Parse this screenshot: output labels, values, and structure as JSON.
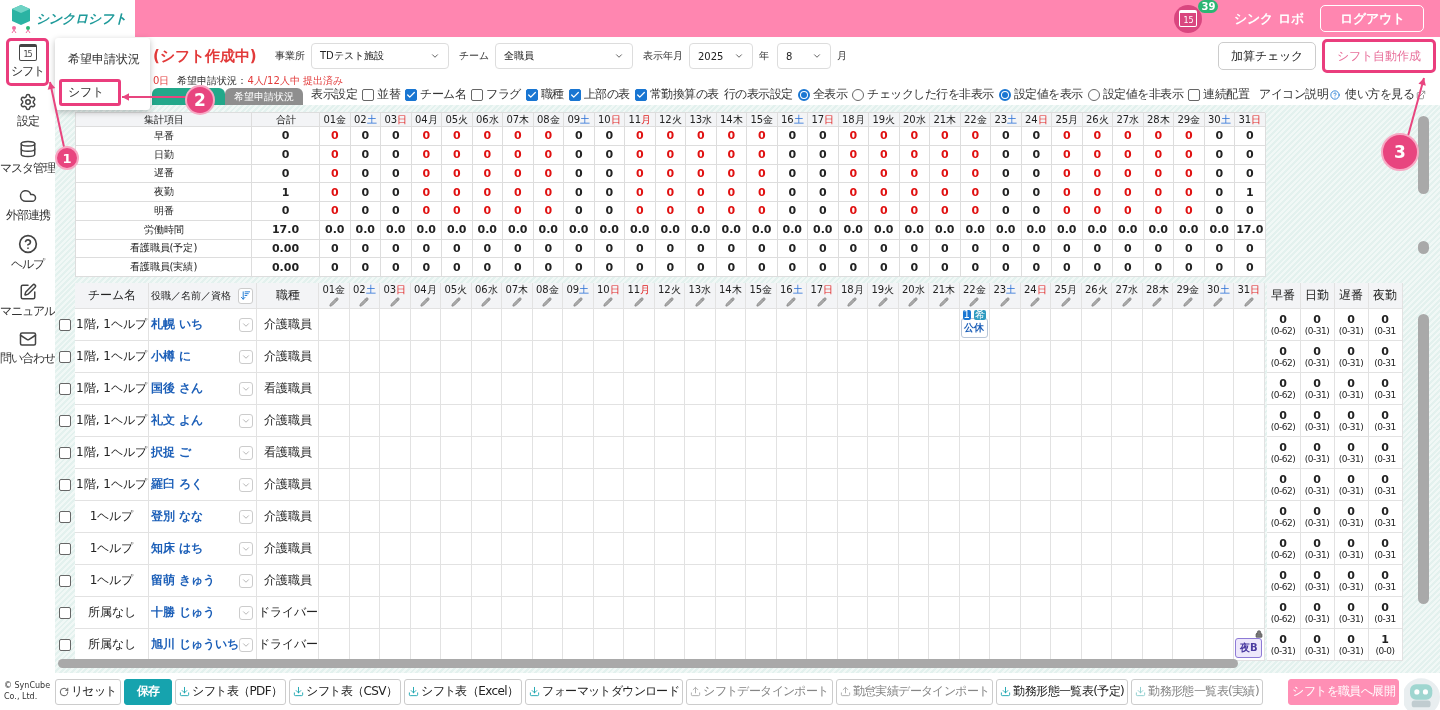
{
  "header": {
    "logo": "シンクロシフト",
    "calendar_day": "15",
    "notification_count": "39",
    "user": "シンク ロボ",
    "logout": "ログアウト"
  },
  "sidebar": {
    "items": [
      {
        "kind": "calendar",
        "label": "シフト",
        "icon_text": "15",
        "highlighted": true
      },
      {
        "kind": "gear",
        "label": "設定",
        "highlighted": false
      },
      {
        "kind": "database",
        "label": "マスタ管理",
        "highlighted": false
      },
      {
        "kind": "cloud",
        "label": "外部連携",
        "highlighted": false
      },
      {
        "kind": "help",
        "label": "ヘルプ",
        "highlighted": false
      },
      {
        "kind": "manual",
        "label": "マニュアル",
        "highlighted": false
      },
      {
        "kind": "mail",
        "label": "問い合わせ",
        "highlighted": false
      }
    ],
    "copyright": "© SynCube Co., Ltd."
  },
  "popup_menu": {
    "items": [
      {
        "label": "希望申請状況",
        "highlighted": false
      },
      {
        "label": "シフト",
        "highlighted": true
      }
    ]
  },
  "title": "(シフト作成中)",
  "deadline_fragment": "0日",
  "request_status": {
    "label": "希望申請状況：",
    "value": "4人/12人中 提出済み"
  },
  "tabs": [
    {
      "selected": true
    },
    {
      "label": "希望申請状況",
      "selected": false
    }
  ],
  "filters": [
    {
      "label": "事業所",
      "value": "TDテスト施設",
      "kind": "wide"
    },
    {
      "label": "チーム",
      "value": "全職員",
      "kind": "wide"
    },
    {
      "label": "表示年月",
      "value": "2025",
      "suffix": "年",
      "kind": "narrow"
    },
    {
      "value": "8",
      "suffix": "月",
      "kind": "narrow"
    }
  ],
  "actions": [
    {
      "label": "加算チェック",
      "highlighted": false
    },
    {
      "label": "シフト自動作成",
      "highlighted": true
    }
  ],
  "display_settings": {
    "label": "表示設定",
    "checkboxes": [
      {
        "label": "並替",
        "checked": false
      },
      {
        "label": "チーム名",
        "checked": true
      },
      {
        "label": "フラグ",
        "checked": false
      },
      {
        "label": "職種",
        "checked": true
      },
      {
        "label": "上部の表",
        "checked": true
      },
      {
        "label": "常勤換算の表",
        "checked": true
      }
    ],
    "row_label": "行の表示設定",
    "row_radios": [
      {
        "label": "全表示",
        "selected": true
      },
      {
        "label": "チェックした行を非表示",
        "selected": false
      }
    ],
    "value_radios": [
      {
        "label": "設定値を表示",
        "selected": true
      },
      {
        "label": "設定値を非表示",
        "selected": false
      }
    ],
    "continuous": {
      "label": "連続配置",
      "checked": false
    },
    "icon_help": "アイコン説明",
    "how_to": "使い方を見る"
  },
  "summary": {
    "columns": {
      "item": "集計項目",
      "total": "合計"
    },
    "days": [
      {
        "num": "01",
        "wd": "金",
        "kind": "weekday"
      },
      {
        "num": "02",
        "wd": "土",
        "kind": "saturday"
      },
      {
        "num": "03",
        "wd": "日",
        "kind": "holiday"
      },
      {
        "num": "04",
        "wd": "月",
        "kind": "weekday"
      },
      {
        "num": "05",
        "wd": "火",
        "kind": "weekday"
      },
      {
        "num": "06",
        "wd": "水",
        "kind": "weekday"
      },
      {
        "num": "07",
        "wd": "木",
        "kind": "weekday"
      },
      {
        "num": "08",
        "wd": "金",
        "kind": "weekday"
      },
      {
        "num": "09",
        "wd": "土",
        "kind": "saturday"
      },
      {
        "num": "10",
        "wd": "日",
        "kind": "holiday"
      },
      {
        "num": "11",
        "wd": "月",
        "kind": "holiday"
      },
      {
        "num": "12",
        "wd": "火",
        "kind": "weekday"
      },
      {
        "num": "13",
        "wd": "水",
        "kind": "weekday"
      },
      {
        "num": "14",
        "wd": "木",
        "kind": "weekday"
      },
      {
        "num": "15",
        "wd": "金",
        "kind": "weekday"
      },
      {
        "num": "16",
        "wd": "土",
        "kind": "saturday"
      },
      {
        "num": "17",
        "wd": "日",
        "kind": "holiday"
      },
      {
        "num": "18",
        "wd": "月",
        "kind": "weekday"
      },
      {
        "num": "19",
        "wd": "火",
        "kind": "weekday"
      },
      {
        "num": "20",
        "wd": "水",
        "kind": "weekday"
      },
      {
        "num": "21",
        "wd": "木",
        "kind": "weekday"
      },
      {
        "num": "22",
        "wd": "金",
        "kind": "weekday"
      },
      {
        "num": "23",
        "wd": "土",
        "kind": "saturday"
      },
      {
        "num": "24",
        "wd": "日",
        "kind": "holiday"
      },
      {
        "num": "25",
        "wd": "月",
        "kind": "weekday"
      },
      {
        "num": "26",
        "wd": "火",
        "kind": "weekday"
      },
      {
        "num": "27",
        "wd": "水",
        "kind": "weekday"
      },
      {
        "num": "28",
        "wd": "木",
        "kind": "weekday"
      },
      {
        "num": "29",
        "wd": "金",
        "kind": "weekday"
      },
      {
        "num": "30",
        "wd": "土",
        "kind": "saturday"
      },
      {
        "num": "31",
        "wd": "日",
        "kind": "holiday"
      }
    ],
    "rows": [
      {
        "label": "早番",
        "total": "0",
        "values": [
          "0",
          "0",
          "0",
          "0",
          "0",
          "0",
          "0",
          "0",
          "0",
          "0",
          "0",
          "0",
          "0",
          "0",
          "0",
          "0",
          "0",
          "0",
          "0",
          "0",
          "0",
          "0",
          "0",
          "0",
          "0",
          "0",
          "0",
          "0",
          "0",
          "0",
          "0"
        ],
        "alerts": [
          true,
          false,
          false,
          true,
          true,
          true,
          true,
          true,
          false,
          false,
          true,
          true,
          true,
          true,
          true,
          false,
          false,
          true,
          true,
          true,
          true,
          true,
          false,
          false,
          true,
          true,
          true,
          true,
          true,
          false,
          false
        ]
      },
      {
        "label": "日勤",
        "total": "0",
        "values": [
          "0",
          "0",
          "0",
          "0",
          "0",
          "0",
          "0",
          "0",
          "0",
          "0",
          "0",
          "0",
          "0",
          "0",
          "0",
          "0",
          "0",
          "0",
          "0",
          "0",
          "0",
          "0",
          "0",
          "0",
          "0",
          "0",
          "0",
          "0",
          "0",
          "0",
          "0"
        ],
        "alerts": [
          true,
          false,
          false,
          true,
          true,
          true,
          true,
          true,
          false,
          false,
          true,
          true,
          true,
          true,
          true,
          false,
          false,
          true,
          true,
          true,
          true,
          true,
          false,
          false,
          true,
          true,
          true,
          true,
          true,
          false,
          false
        ]
      },
      {
        "label": "遅番",
        "total": "0",
        "values": [
          "0",
          "0",
          "0",
          "0",
          "0",
          "0",
          "0",
          "0",
          "0",
          "0",
          "0",
          "0",
          "0",
          "0",
          "0",
          "0",
          "0",
          "0",
          "0",
          "0",
          "0",
          "0",
          "0",
          "0",
          "0",
          "0",
          "0",
          "0",
          "0",
          "0",
          "0"
        ],
        "alerts": [
          true,
          false,
          false,
          true,
          true,
          true,
          true,
          true,
          false,
          false,
          true,
          true,
          true,
          true,
          true,
          false,
          false,
          true,
          true,
          true,
          true,
          true,
          false,
          false,
          true,
          true,
          true,
          true,
          true,
          false,
          false
        ]
      },
      {
        "label": "夜勤",
        "total": "1",
        "values": [
          "0",
          "0",
          "0",
          "0",
          "0",
          "0",
          "0",
          "0",
          "0",
          "0",
          "0",
          "0",
          "0",
          "0",
          "0",
          "0",
          "0",
          "0",
          "0",
          "0",
          "0",
          "0",
          "0",
          "0",
          "0",
          "0",
          "0",
          "0",
          "0",
          "0",
          "1"
        ],
        "alerts": [
          true,
          false,
          false,
          true,
          true,
          true,
          true,
          true,
          false,
          false,
          true,
          true,
          true,
          true,
          true,
          false,
          false,
          true,
          true,
          true,
          true,
          true,
          false,
          false,
          true,
          true,
          true,
          true,
          true,
          false,
          false
        ]
      },
      {
        "label": "明番",
        "total": "0",
        "values": [
          "0",
          "0",
          "0",
          "0",
          "0",
          "0",
          "0",
          "0",
          "0",
          "0",
          "0",
          "0",
          "0",
          "0",
          "0",
          "0",
          "0",
          "0",
          "0",
          "0",
          "0",
          "0",
          "0",
          "0",
          "0",
          "0",
          "0",
          "0",
          "0",
          "0",
          "0"
        ],
        "alerts": [
          true,
          false,
          false,
          true,
          true,
          true,
          true,
          true,
          false,
          false,
          true,
          true,
          true,
          true,
          true,
          false,
          false,
          true,
          true,
          true,
          true,
          true,
          false,
          false,
          true,
          true,
          true,
          true,
          true,
          false,
          false
        ]
      },
      {
        "label": "労働時間",
        "total": "17.0",
        "values": [
          "0.0",
          "0.0",
          "0.0",
          "0.0",
          "0.0",
          "0.0",
          "0.0",
          "0.0",
          "0.0",
          "0.0",
          "0.0",
          "0.0",
          "0.0",
          "0.0",
          "0.0",
          "0.0",
          "0.0",
          "0.0",
          "0.0",
          "0.0",
          "0.0",
          "0.0",
          "0.0",
          "0.0",
          "0.0",
          "0.0",
          "0.0",
          "0.0",
          "0.0",
          "0.0",
          "17.0"
        ]
      },
      {
        "label": "看護職員(予定)",
        "total": "0.00",
        "values": [
          "0",
          "0",
          "0",
          "0",
          "0",
          "0",
          "0",
          "0",
          "0",
          "0",
          "0",
          "0",
          "0",
          "0",
          "0",
          "0",
          "0",
          "0",
          "0",
          "0",
          "0",
          "0",
          "0",
          "0",
          "0",
          "0",
          "0",
          "0",
          "0",
          "0",
          "0"
        ]
      },
      {
        "label": "看護職員(実績)",
        "total": "0.00",
        "values": [
          "0",
          "0",
          "0",
          "0",
          "0",
          "0",
          "0",
          "0",
          "0",
          "0",
          "0",
          "0",
          "0",
          "0",
          "0",
          "0",
          "0",
          "0",
          "0",
          "0",
          "0",
          "0",
          "0",
          "0",
          "0",
          "0",
          "0",
          "0",
          "0",
          "0",
          "0"
        ]
      }
    ]
  },
  "staff": {
    "columns": {
      "team": "チーム名",
      "name": "役職／名前／資格",
      "job": "職種"
    },
    "days": [
      {
        "num": "01",
        "wd": "金",
        "kind": "weekday"
      },
      {
        "num": "02",
        "wd": "土",
        "kind": "saturday"
      },
      {
        "num": "03",
        "wd": "日",
        "kind": "holiday"
      },
      {
        "num": "04",
        "wd": "月",
        "kind": "weekday"
      },
      {
        "num": "05",
        "wd": "火",
        "kind": "weekday"
      },
      {
        "num": "06",
        "wd": "水",
        "kind": "weekday"
      },
      {
        "num": "07",
        "wd": "木",
        "kind": "weekday"
      },
      {
        "num": "08",
        "wd": "金",
        "kind": "weekday"
      },
      {
        "num": "09",
        "wd": "土",
        "kind": "saturday"
      },
      {
        "num": "10",
        "wd": "日",
        "kind": "holiday"
      },
      {
        "num": "11",
        "wd": "月",
        "kind": "holiday"
      },
      {
        "num": "12",
        "wd": "火",
        "kind": "weekday"
      },
      {
        "num": "13",
        "wd": "水",
        "kind": "weekday"
      },
      {
        "num": "14",
        "wd": "木",
        "kind": "weekday"
      },
      {
        "num": "15",
        "wd": "金",
        "kind": "weekday"
      },
      {
        "num": "16",
        "wd": "土",
        "kind": "saturday"
      },
      {
        "num": "17",
        "wd": "日",
        "kind": "holiday"
      },
      {
        "num": "18",
        "wd": "月",
        "kind": "weekday"
      },
      {
        "num": "19",
        "wd": "火",
        "kind": "weekday"
      },
      {
        "num": "20",
        "wd": "水",
        "kind": "weekday"
      },
      {
        "num": "21",
        "wd": "木",
        "kind": "weekday"
      },
      {
        "num": "22",
        "wd": "金",
        "kind": "weekday"
      },
      {
        "num": "23",
        "wd": "土",
        "kind": "saturday"
      },
      {
        "num": "24",
        "wd": "日",
        "kind": "holiday"
      },
      {
        "num": "25",
        "wd": "月",
        "kind": "weekday"
      },
      {
        "num": "26",
        "wd": "火",
        "kind": "weekday"
      },
      {
        "num": "27",
        "wd": "水",
        "kind": "weekday"
      },
      {
        "num": "28",
        "wd": "木",
        "kind": "weekday"
      },
      {
        "num": "29",
        "wd": "金",
        "kind": "weekday"
      },
      {
        "num": "30",
        "wd": "土",
        "kind": "saturday"
      },
      {
        "num": "31",
        "wd": "日",
        "kind": "holiday"
      }
    ],
    "total_columns": [
      "早番",
      "日勤",
      "遅番",
      "夜勤"
    ],
    "rows": [
      {
        "checked": false,
        "team": "1階, 1ヘルプ",
        "name": "札幌 いち",
        "job": "介護職員",
        "shifts": {
          "day_22": {
            "label": "公休",
            "kind": "holiday",
            "badges": [
              "1",
              "希"
            ]
          }
        },
        "totals": [
          {
            "count": "0",
            "range": "(0-62)"
          },
          {
            "count": "0",
            "range": "(0-31)"
          },
          {
            "count": "0",
            "range": "(0-31)"
          },
          {
            "count": "0",
            "range": "(0-31"
          }
        ]
      },
      {
        "checked": false,
        "team": "1階, 1ヘルプ",
        "name": "小樽 に",
        "job": "介護職員",
        "totals": [
          {
            "count": "0",
            "range": "(0-62)"
          },
          {
            "count": "0",
            "range": "(0-31)"
          },
          {
            "count": "0",
            "range": "(0-31)"
          },
          {
            "count": "0",
            "range": "(0-31"
          }
        ]
      },
      {
        "checked": false,
        "team": "1階, 1ヘルプ",
        "name": "国後 さん",
        "job": "看護職員",
        "totals": [
          {
            "count": "0",
            "range": "(0-62)"
          },
          {
            "count": "0",
            "range": "(0-31)"
          },
          {
            "count": "0",
            "range": "(0-31)"
          },
          {
            "count": "0",
            "range": "(0-31"
          }
        ]
      },
      {
        "checked": false,
        "team": "1階, 1ヘルプ",
        "name": "礼文 よん",
        "job": "介護職員",
        "totals": [
          {
            "count": "0",
            "range": "(0-62)"
          },
          {
            "count": "0",
            "range": "(0-31)"
          },
          {
            "count": "0",
            "range": "(0-31)"
          },
          {
            "count": "0",
            "range": "(0-31"
          }
        ]
      },
      {
        "checked": false,
        "team": "1階, 1ヘルプ",
        "name": "択捉 ご",
        "job": "看護職員",
        "totals": [
          {
            "count": "0",
            "range": "(0-62)"
          },
          {
            "count": "0",
            "range": "(0-31)"
          },
          {
            "count": "0",
            "range": "(0-31)"
          },
          {
            "count": "0",
            "range": "(0-31"
          }
        ]
      },
      {
        "checked": false,
        "team": "1階, 1ヘルプ",
        "name": "羅臼 ろく",
        "job": "介護職員",
        "totals": [
          {
            "count": "0",
            "range": "(0-62)"
          },
          {
            "count": "0",
            "range": "(0-31)"
          },
          {
            "count": "0",
            "range": "(0-31)"
          },
          {
            "count": "0",
            "range": "(0-31"
          }
        ]
      },
      {
        "checked": false,
        "team": "1ヘルプ",
        "name": "登別 なな",
        "job": "介護職員",
        "totals": [
          {
            "count": "0",
            "range": "(0-62)"
          },
          {
            "count": "0",
            "range": "(0-31)"
          },
          {
            "count": "0",
            "range": "(0-31)"
          },
          {
            "count": "0",
            "range": "(0-31"
          }
        ]
      },
      {
        "checked": false,
        "team": "1ヘルプ",
        "name": "知床 はち",
        "job": "介護職員",
        "totals": [
          {
            "count": "0",
            "range": "(0-62)"
          },
          {
            "count": "0",
            "range": "(0-31)"
          },
          {
            "count": "0",
            "range": "(0-31)"
          },
          {
            "count": "0",
            "range": "(0-31"
          }
        ]
      },
      {
        "checked": false,
        "team": "1ヘルプ",
        "name": "留萌 きゅう",
        "job": "介護職員",
        "totals": [
          {
            "count": "0",
            "range": "(0-62)"
          },
          {
            "count": "0",
            "range": "(0-31)"
          },
          {
            "count": "0",
            "range": "(0-31)"
          },
          {
            "count": "0",
            "range": "(0-31"
          }
        ]
      },
      {
        "checked": false,
        "team": "所属なし",
        "name": "十勝 じゅう",
        "job": "ドライバー",
        "totals": [
          {
            "count": "0",
            "range": "(0-62)"
          },
          {
            "count": "0",
            "range": "(0-31)"
          },
          {
            "count": "0",
            "range": "(0-31)"
          },
          {
            "count": "0",
            "range": "(0-31"
          }
        ]
      },
      {
        "checked": false,
        "team": "所属なし",
        "name": "旭川 じゅういち",
        "job": "ドライバー",
        "shifts": {
          "day_31": {
            "label": "夜B",
            "kind": "night",
            "locked": true
          }
        },
        "totals": [
          {
            "count": "0",
            "range": "(0-31)"
          },
          {
            "count": "0",
            "range": "(0-31)"
          },
          {
            "count": "0",
            "range": "(0-31)"
          },
          {
            "count": "1",
            "range": "(0-0)"
          }
        ]
      }
    ]
  },
  "callouts": [
    "1",
    "2",
    "3"
  ],
  "footer": {
    "buttons": [
      {
        "label": "リセット",
        "kind": "reset",
        "disabled": false
      },
      {
        "label": "保存",
        "kind": "primary",
        "disabled": false
      },
      {
        "label": "シフト表（PDF）",
        "kind": "download",
        "disabled": false
      },
      {
        "label": "シフト表（CSV）",
        "kind": "download",
        "disabled": false
      },
      {
        "label": "シフト表（Excel）",
        "kind": "download",
        "disabled": false
      },
      {
        "label": "フォーマットダウンロード",
        "kind": "download",
        "disabled": false
      },
      {
        "label": "シフトデータインポート",
        "kind": "upload",
        "disabled": true
      },
      {
        "label": "勤怠実績データインポート",
        "kind": "upload",
        "disabled": true
      },
      {
        "label": "勤務形態一覧表(予定)",
        "kind": "download",
        "disabled": false
      },
      {
        "label": "勤務形態一覧表(実績)",
        "kind": "download",
        "disabled": true
      },
      {
        "label": "シフトを職員へ展開",
        "kind": "accent",
        "disabled": false
      }
    ]
  }
}
